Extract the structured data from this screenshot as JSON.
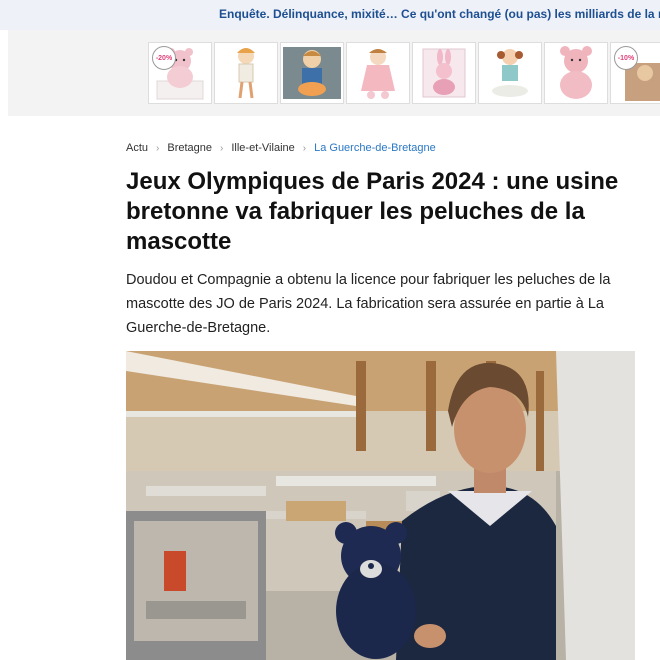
{
  "top_banner": {
    "text": "Enquête. Délinquance, mixité… Ce qu'ont changé (ou pas) les milliards de la réno"
  },
  "ad_strip": {
    "items": [
      {
        "name": "pink-bear-plush",
        "badge": "-20%"
      },
      {
        "name": "girl-doll-plush",
        "badge": ""
      },
      {
        "name": "boy-doll-plush",
        "badge": ""
      },
      {
        "name": "bunny-doll-plush",
        "badge": ""
      },
      {
        "name": "pink-bunny-box",
        "badge": ""
      },
      {
        "name": "rag-doll-plush",
        "badge": ""
      },
      {
        "name": "pink-teddy-bear",
        "badge": ""
      },
      {
        "name": "partial-product",
        "badge": "-10%"
      }
    ]
  },
  "breadcrumb": {
    "items": [
      "Actu",
      "Bretagne",
      "Ille-et-Vilaine",
      "La Guerche-de-Bretagne"
    ]
  },
  "article": {
    "title": "Jeux Olympiques de Paris 2024 : une usine bretonne va fabriquer les peluches de la mascotte",
    "lead": "Doudou et Compagnie a obtenu la licence pour fabriquer les peluches de la mascotte des JO de Paris 2024. La fabrication sera assurée en partie à La Guerche-de-Bretagne."
  },
  "colors": {
    "accent_link": "#2b78c5",
    "banner_link": "#1d4f91",
    "banner_bg": "#eef1f8"
  }
}
